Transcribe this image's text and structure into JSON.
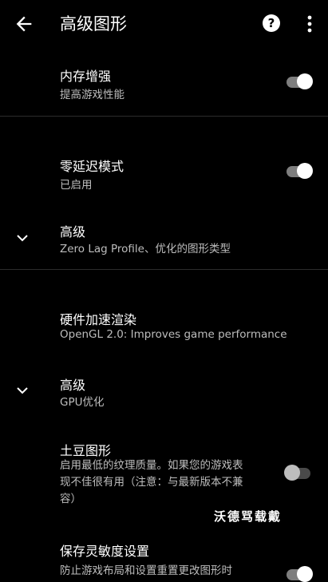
{
  "appbar": {
    "title": "高级图形",
    "back_icon": "arrow-left-icon",
    "help_icon": "help-circle-icon",
    "more_icon": "more-vert-icon"
  },
  "settings": [
    {
      "title": "内存增强",
      "subtitle": "提高游戏性能",
      "toggle": true
    },
    {
      "title": "零延迟模式",
      "subtitle": "已启用",
      "toggle": true
    },
    {
      "title": "高级",
      "subtitle": "Zero Lag Profile、优化的图形类型",
      "expandable": true
    },
    {
      "title": "硬件加速渲染",
      "subtitle": "OpenGL 2.0: Improves game performance"
    },
    {
      "title": "高级",
      "subtitle": "GPU优化",
      "expandable": true
    },
    {
      "title": "土豆图形",
      "subtitle": "启用最低的纹理质量。如果您的游戏表现不佳很有用（注意：与最新版本不兼容）",
      "toggle": false
    },
    {
      "title": "保存灵敏度设置",
      "subtitle": "防止游戏布局和设置重置更改图形时",
      "toggle": true
    }
  ],
  "watermark": "沃德骂载戴",
  "colors": {
    "background": "#000000",
    "text_primary": "#ffffff",
    "text_secondary": "#bdbdbd",
    "switch_on_thumb": "#ffffff",
    "switch_off_thumb": "#bdbdbd"
  }
}
